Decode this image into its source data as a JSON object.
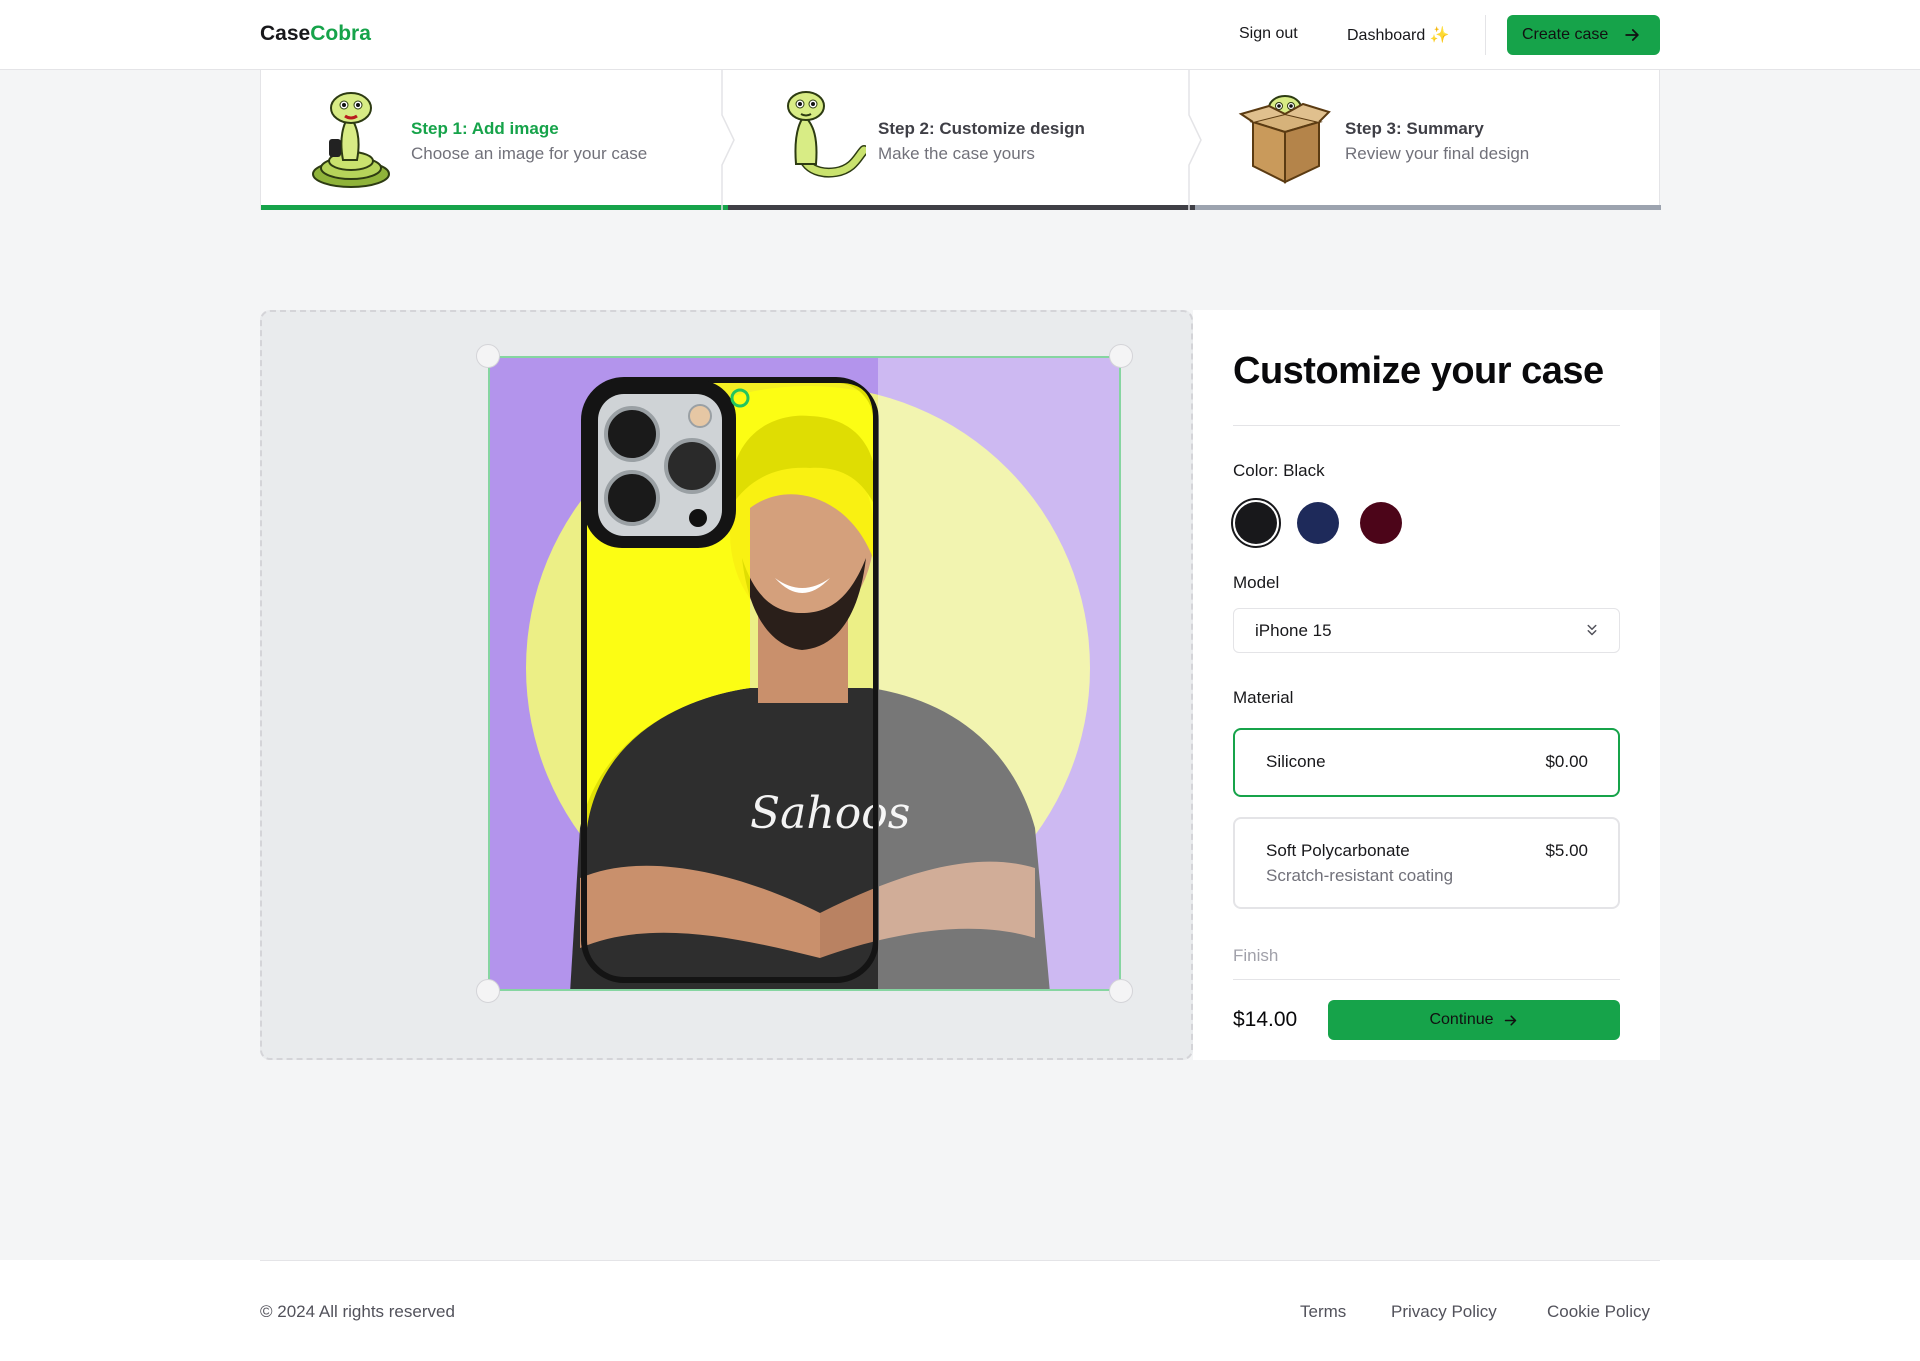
{
  "brand": {
    "part1": "Case",
    "part2": "Cobra",
    "accent_color": "#16a34a"
  },
  "nav": {
    "sign_out": "Sign out",
    "dashboard": "Dashboard",
    "dashboard_emoji": "✨",
    "create_case": "Create case"
  },
  "steps": [
    {
      "title": "Step 1: Add image",
      "subtitle": "Choose an image for your case",
      "state": "complete"
    },
    {
      "title": "Step 2: Customize design",
      "subtitle": "Make the case yours",
      "state": "current"
    },
    {
      "title": "Step 3: Summary",
      "subtitle": "Review your final design",
      "state": "upcoming"
    }
  ],
  "panel": {
    "heading": "Customize your case",
    "color_label": "Color: Black",
    "colors": [
      {
        "name": "Black",
        "hex": "#18181b",
        "selected": true
      },
      {
        "name": "Blue",
        "hex": "#1e2a5a",
        "selected": false
      },
      {
        "name": "Rose",
        "hex": "#4c0519",
        "selected": false
      }
    ],
    "model_label": "Model",
    "model_value": "iPhone 15",
    "material_label": "Material",
    "materials": [
      {
        "name": "Silicone",
        "price": "$0.00",
        "description": "",
        "selected": true
      },
      {
        "name": "Soft Polycarbonate",
        "price": "$5.00",
        "description": "Scratch-resistant coating",
        "selected": false
      }
    ],
    "finish_label": "Finish",
    "total": "$14.00",
    "continue": "Continue"
  },
  "footer": {
    "copyright": "© 2024 All rights reserved",
    "links": [
      "Terms",
      "Privacy Policy",
      "Cookie Policy"
    ]
  }
}
